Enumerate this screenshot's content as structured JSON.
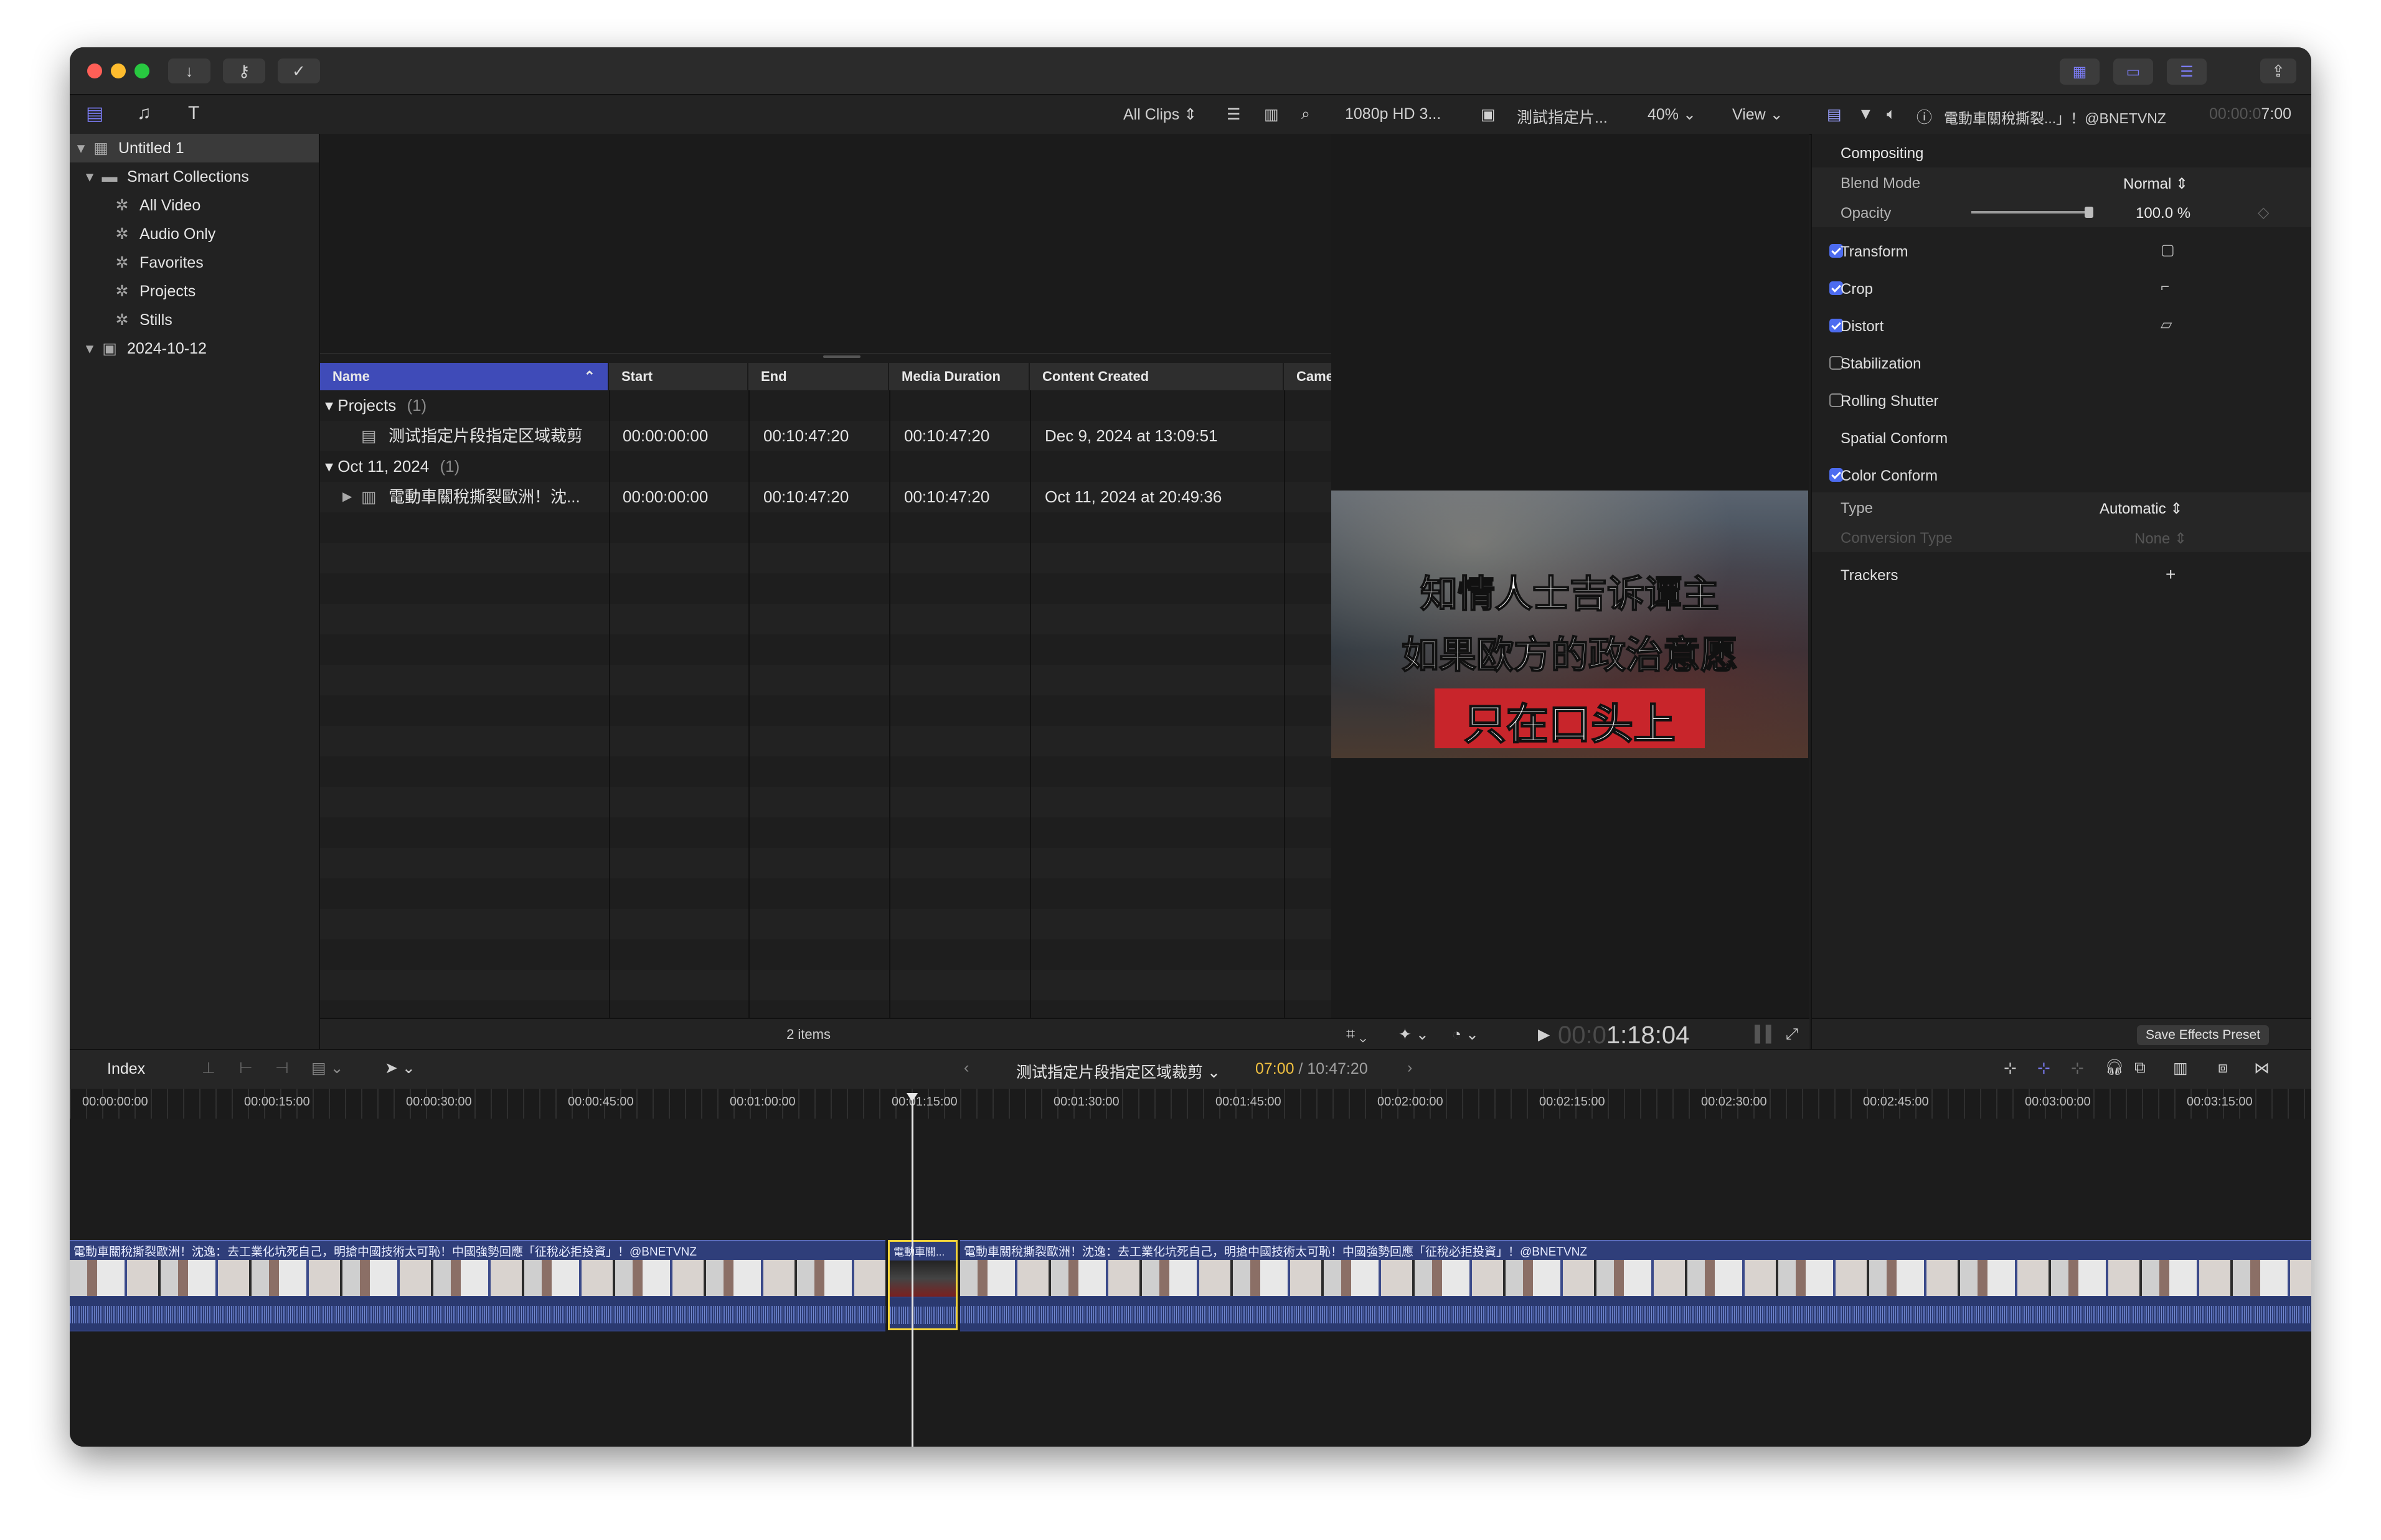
{
  "colors": {
    "accent": "#7b7cf5",
    "selection": "#3f4bb8",
    "clip": "#2f3e7a",
    "playhead": "#e7e7e7",
    "selected_clip_border": "#f1d23a"
  },
  "titlebar": {
    "icons": [
      "import-icon",
      "key-icon",
      "checkmark-icon"
    ],
    "right_icons": [
      "library-view-icon",
      "timeline-view-icon",
      "inspector-view-icon",
      "share-icon"
    ]
  },
  "browser_toolbar": {
    "filter": "All Clips",
    "format": "1080p HD 3...",
    "project_title": "測試指定片...",
    "zoom": "40%",
    "view": "View"
  },
  "sidebar": {
    "items": [
      {
        "label": "Untitled 1"
      },
      {
        "label": "Smart Collections"
      },
      {
        "label": "All Video"
      },
      {
        "label": "Audio Only"
      },
      {
        "label": "Favorites"
      },
      {
        "label": "Projects"
      },
      {
        "label": "Stills"
      },
      {
        "label": "2024-10-12"
      }
    ]
  },
  "browser": {
    "columns": [
      "Name",
      "Start",
      "End",
      "Media Duration",
      "Content Created",
      "Came"
    ],
    "groups": [
      {
        "label": "Projects",
        "count": "(1)",
        "rows": [
          {
            "name": "测试指定片段指定区域裁剪",
            "start": "00:00:00:00",
            "end": "00:10:47:20",
            "duration": "00:10:47:20",
            "created": "Dec 9, 2024 at 13:09:51"
          }
        ]
      },
      {
        "label": "Oct 11, 2024",
        "count": "(1)",
        "rows": [
          {
            "name": "電動車關稅撕裂歐洲！沈...",
            "start": "00:00:00:00",
            "end": "00:10:47:20",
            "duration": "00:10:47:20",
            "created": "Oct 11, 2024 at 20:49:36"
          }
        ]
      }
    ],
    "footer": "2 items"
  },
  "viewer": {
    "subtitle_lines": [
      "知情人士吉诉谭主",
      "如果欧方的政治意愿",
      "只在口头上"
    ],
    "timecode_dim": "00:0",
    "timecode": "1:18:04"
  },
  "inspector": {
    "clip_name": "電動車關稅撕裂...」！@BNETVNZ",
    "clip_time_dim": "00:00:0",
    "clip_time": "7:00",
    "compositing": "Compositing",
    "blend_mode_label": "Blend Mode",
    "blend_mode_value": "Normal",
    "opacity_label": "Opacity",
    "opacity_value": "100.0",
    "opacity_unit": "%",
    "opacity_level": 1.0,
    "sections": [
      {
        "label": "Transform",
        "checked": true
      },
      {
        "label": "Crop",
        "checked": true
      },
      {
        "label": "Distort",
        "checked": true
      },
      {
        "label": "Stabilization",
        "checked": false
      },
      {
        "label": "Rolling Shutter",
        "checked": false
      },
      {
        "label": "Spatial Conform"
      },
      {
        "label": "Color Conform",
        "checked": true
      }
    ],
    "type_label": "Type",
    "type_value": "Automatic",
    "conversion_label": "Conversion Type",
    "conversion_value": "None",
    "trackers_label": "Trackers",
    "trackers_add": "+",
    "save_preset": "Save Effects Preset"
  },
  "timeline_bar": {
    "index": "Index",
    "project": "测试指定片段指定区域裁剪",
    "pos": "07:00",
    "total": "/ 10:47:20"
  },
  "ruler": [
    "00:00:00:00",
    "00:00:15:00",
    "00:00:30:00",
    "00:00:45:00",
    "00:01:00:00",
    "00:01:15:00",
    "00:01:30:00",
    "00:01:45:00",
    "00:02:00:00",
    "00:02:15:00",
    "00:02:30:00",
    "00:02:45:00",
    "00:03:00:00",
    "00:03:15:00"
  ],
  "clips": {
    "left": "電動車關稅撕裂歐洲！沈逸：去工業化坑死自己，明搶中國技術太可恥！中國強勢回應「征稅必拒投資」！@BNETVNZ",
    "middle": "電動車關...",
    "right": "電動車關稅撕裂歐洲！沈逸：去工業化坑死自己，明搶中國技術太可恥！中國強勢回應「征稅必拒投資」！@BNETVNZ"
  }
}
